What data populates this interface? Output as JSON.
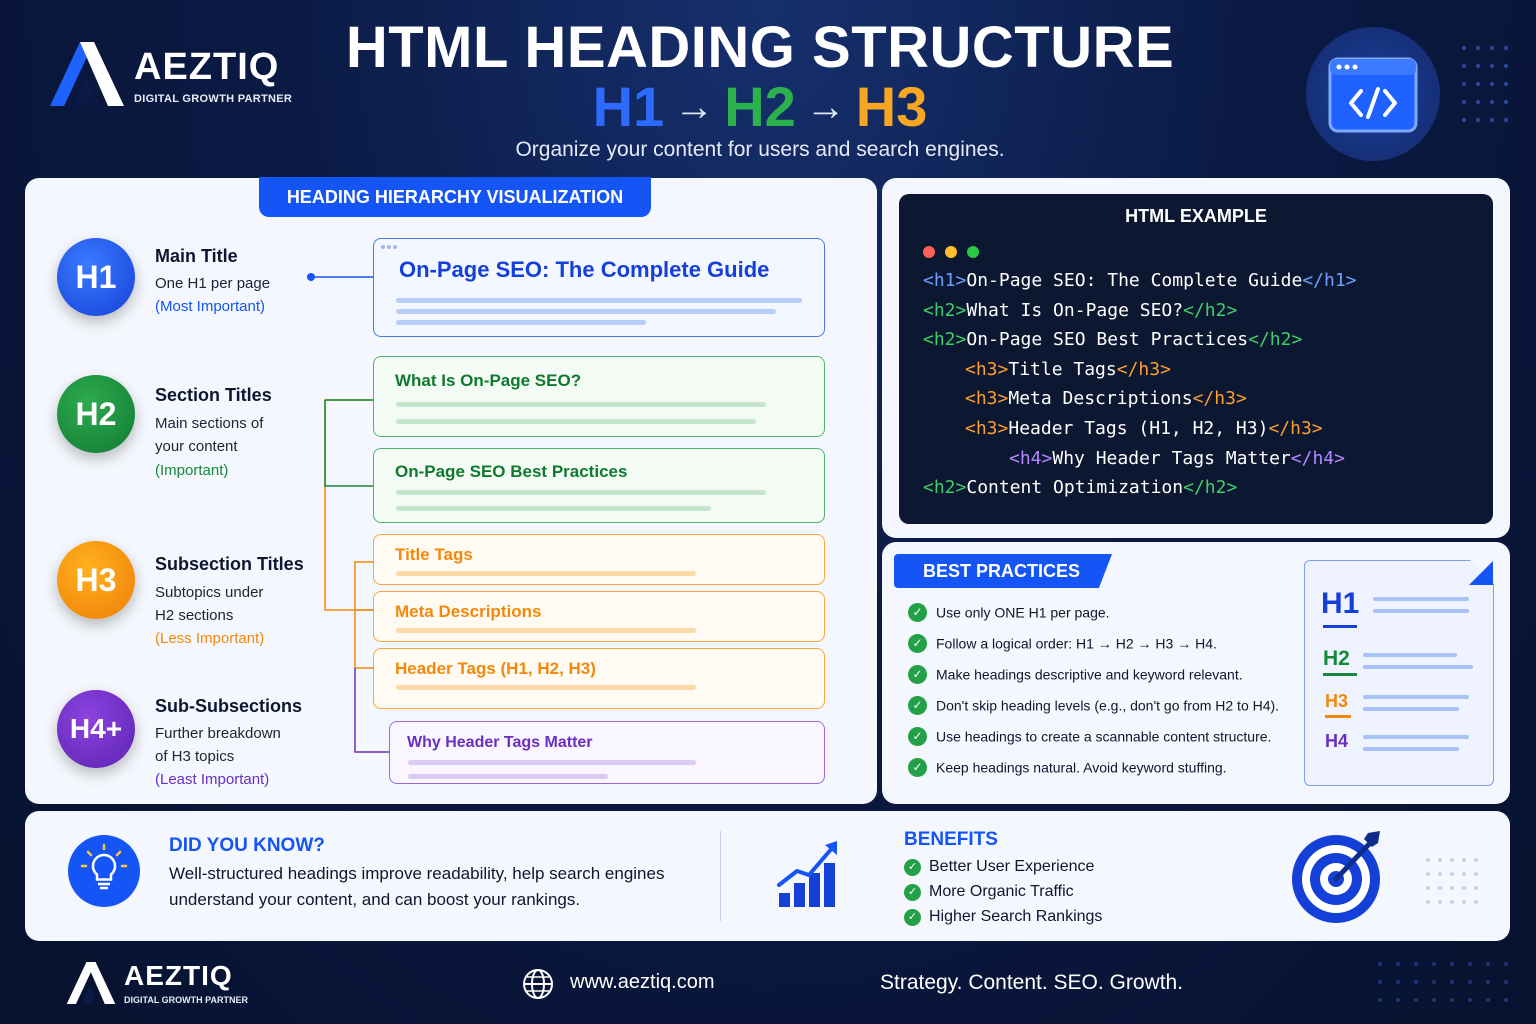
{
  "brand": {
    "name": "AEZTIQ",
    "tagline": "DIGITAL GROWTH PARTNER"
  },
  "header": {
    "title": "HTML HEADING STRUCTURE",
    "sequence": [
      "H1",
      "H2",
      "H3"
    ],
    "arrow": "→",
    "subtitle": "Organize your content for users and search engines."
  },
  "hierarchy": {
    "tab_title": "HEADING HIERARCHY VISUALIZATION",
    "levels": [
      {
        "badge": "H1",
        "title": "Main Title",
        "desc": [
          "One H1 per page"
        ],
        "importance": "(Most Important)",
        "color": "#1555f5"
      },
      {
        "badge": "H2",
        "title": "Section Titles",
        "desc": [
          "Main sections of",
          "your content"
        ],
        "importance": "(Important)",
        "color": "#138a38"
      },
      {
        "badge": "H3",
        "title": "Subsection Titles",
        "desc": [
          "Subtopics under",
          "H2 sections"
        ],
        "importance": "(Less Important)",
        "color": "#f2890c"
      },
      {
        "badge": "H4+",
        "title": "Sub-Subsections",
        "desc": [
          "Further breakdown",
          "of H3 topics"
        ],
        "importance": "(Least Important)",
        "color": "#6a2fc2"
      }
    ],
    "cards": {
      "h1": "On-Page SEO: The Complete Guide",
      "h2": [
        "What Is On-Page SEO?",
        "On-Page SEO Best Practices"
      ],
      "h3": [
        "Title Tags",
        "Meta Descriptions",
        "Header Tags (H1, H2, H3)"
      ],
      "h4": "Why Header Tags Matter"
    }
  },
  "html_example": {
    "title": "HTML EXAMPLE",
    "lines": [
      {
        "open": "<h1>",
        "text": "On-Page SEO: The Complete Guide",
        "close": "</h1>",
        "tag_color": "#6ea0ff"
      },
      {
        "open": "<h2>",
        "text": "What Is On-Page SEO?",
        "close": "</h2>",
        "tag_color": "#3fcf68"
      },
      {
        "open": "<h2>",
        "text": "On-Page SEO Best Practices",
        "close": "</h2>",
        "tag_color": "#3fcf68"
      },
      {
        "open": "<h3>",
        "text": "Title Tags",
        "close": "</h3>",
        "tag_color": "#ff9d2e"
      },
      {
        "open": "<h3>",
        "text": "Meta Descriptions",
        "close": "</h3>",
        "tag_color": "#ff9d2e"
      },
      {
        "open": "<h3>",
        "text": "Header Tags (H1, H2, H3)",
        "close": "</h3>",
        "tag_color": "#ff9d2e"
      },
      {
        "open": "<h4>",
        "text": "Why Header Tags Matter",
        "close": "</h4>",
        "tag_color": "#b488ff"
      },
      {
        "open": "<h2>",
        "text": "Content Optimization",
        "close": "</h2>",
        "tag_color": "#3fcf68"
      }
    ]
  },
  "best_practices": {
    "title": "BEST PRACTICES",
    "items": [
      "Use only ONE H1 per page.",
      "Follow a logical order: H1 → H2 → H3 → H4.",
      "Make headings descriptive and keyword relevant.",
      "Don't skip heading levels (e.g., don't go from H2 to H4).",
      "Use headings to create a scannable content structure.",
      "Keep headings natural. Avoid keyword stuffing."
    ],
    "doc_labels": [
      "H1",
      "H2",
      "H3",
      "H4"
    ]
  },
  "did_you_know": {
    "title": "DID YOU KNOW?",
    "lines": [
      "Well-structured headings improve readability, help search engines",
      "understand your content, and can boost your rankings."
    ]
  },
  "benefits": {
    "title": "BENEFITS",
    "items": [
      "Better User Experience",
      "More Organic Traffic",
      "Higher Search Rankings"
    ]
  },
  "footer": {
    "website": "www.aeztiq.com",
    "slogan": "Strategy. Content. SEO. Growth."
  },
  "icons": {
    "logo": "aeztiq-logo-icon",
    "code": "code-window-icon",
    "bulb": "lightbulb-icon",
    "chart": "growth-chart-icon",
    "target": "target-icon",
    "globe": "globe-icon",
    "check": "check-icon"
  }
}
